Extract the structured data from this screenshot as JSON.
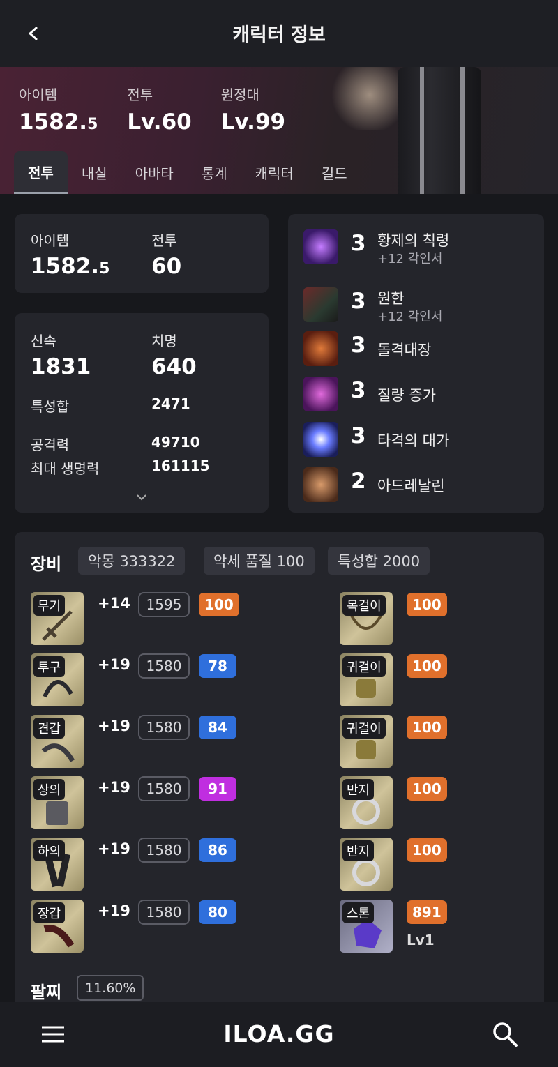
{
  "header": {
    "title": "캐릭터 정보",
    "back_icon": "chevron-left-icon"
  },
  "hero": {
    "stats": [
      {
        "label": "아이템",
        "value_main": "1582.",
        "value_small": "5"
      },
      {
        "label": "전투",
        "value_main": "Lv.60",
        "value_small": ""
      },
      {
        "label": "원정대",
        "value_main": "Lv.99",
        "value_small": ""
      }
    ],
    "tabs": [
      "전투",
      "내실",
      "아바타",
      "통계",
      "캐릭터",
      "길드"
    ],
    "active_tab": "전투"
  },
  "summary": {
    "item_label": "아이템",
    "item_main": "1582.",
    "item_small": "5",
    "combat_label": "전투",
    "combat_value": "60"
  },
  "stats": {
    "swift_label": "신속",
    "swift_value": "1831",
    "crit_label": "치명",
    "crit_value": "640",
    "rows": [
      {
        "label": "특성합",
        "value": "2471"
      },
      {
        "label": "공격력",
        "value": "49710"
      },
      {
        "label": "최대 생명력",
        "value": "161115"
      }
    ],
    "expand_icon": "chevron-down-icon"
  },
  "engravings": [
    {
      "level": "3",
      "name": "황제의 칙령",
      "sub": "+12 각인서",
      "icon": "emperor-decree-icon"
    },
    {
      "level": "3",
      "name": "원한",
      "sub": "+12 각인서",
      "icon": "grudge-icon"
    },
    {
      "level": "3",
      "name": "돌격대장",
      "sub": "",
      "icon": "raid-captain-icon"
    },
    {
      "level": "3",
      "name": "질량 증가",
      "sub": "",
      "icon": "mass-increase-icon"
    },
    {
      "level": "3",
      "name": "타격의 대가",
      "sub": "",
      "icon": "hit-master-icon"
    },
    {
      "level": "2",
      "name": "아드레날린",
      "sub": "",
      "icon": "adrenaline-icon"
    }
  ],
  "equipment": {
    "title": "장비",
    "chips": [
      "악몽 333322",
      "악세 품질 100",
      "특성합 2000"
    ],
    "gear": [
      {
        "slot": "무기",
        "enhance": "+14",
        "item_level": "1595",
        "quality": "100",
        "quality_color": "#e0702c"
      },
      {
        "slot": "투구",
        "enhance": "+19",
        "item_level": "1580",
        "quality": "78",
        "quality_color": "#2f6fdc"
      },
      {
        "slot": "견갑",
        "enhance": "+19",
        "item_level": "1580",
        "quality": "84",
        "quality_color": "#2f6fdc"
      },
      {
        "slot": "상의",
        "enhance": "+19",
        "item_level": "1580",
        "quality": "91",
        "quality_color": "#c02ee0"
      },
      {
        "slot": "하의",
        "enhance": "+19",
        "item_level": "1580",
        "quality": "86",
        "quality_color": "#2f6fdc"
      },
      {
        "slot": "장갑",
        "enhance": "+19",
        "item_level": "1580",
        "quality": "80",
        "quality_color": "#2f6fdc"
      }
    ],
    "accessories": [
      {
        "slot": "목걸이",
        "quality": "100",
        "sub": ""
      },
      {
        "slot": "귀걸이",
        "quality": "100",
        "sub": ""
      },
      {
        "slot": "귀걸이",
        "quality": "100",
        "sub": ""
      },
      {
        "slot": "반지",
        "quality": "100",
        "sub": ""
      },
      {
        "slot": "반지",
        "quality": "100",
        "sub": ""
      },
      {
        "slot": "스톤",
        "quality": "891",
        "sub": "Lv1"
      }
    ],
    "accessory_quality_color": "#e0702c",
    "bracelet_title": "팔찌",
    "bracelet_value": "11.60%"
  },
  "footer": {
    "logo": "ILOA.GG",
    "menu_icon": "hamburger-icon",
    "search_icon": "search-icon"
  }
}
